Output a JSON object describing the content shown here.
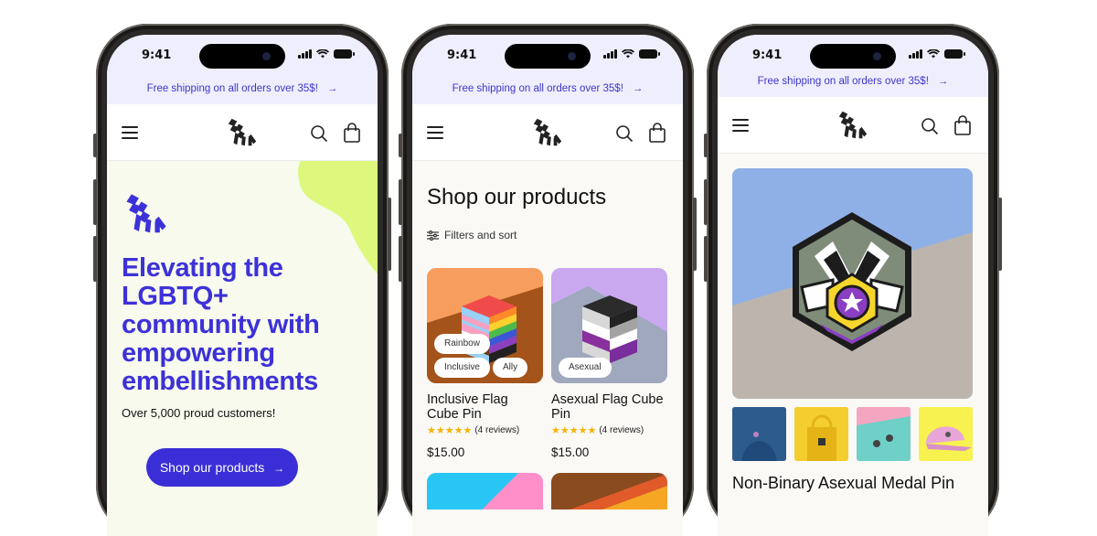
{
  "colors": {
    "brand": "#3a2fd6",
    "announce_bg": "#efeefd",
    "hero_bg": "#f7faed",
    "blob": "#ddf87c",
    "star": "#f5b301"
  },
  "status_bar": {
    "time": "9:41"
  },
  "announcement": {
    "text": "Free shipping on all orders over 35$!",
    "arrow": "→"
  },
  "header": {
    "menu_icon": "hamburger-icon",
    "logo": "brand-logo",
    "search_icon": "search-icon",
    "cart_icon": "shopping-bag-icon"
  },
  "home": {
    "headline": "Elevating the LGBTQ+ community with empowering embellishments",
    "subtext": "Over 5,000 proud customers!",
    "cta_label": "Shop our products",
    "cta_arrow": "→"
  },
  "collection": {
    "title": "Shop our products",
    "filters_label": "Filters and sort",
    "products": [
      {
        "name": "Inclusive Flag Cube Pin",
        "stars": "★★★★★",
        "reviews": "(4 reviews)",
        "price": "$15.00",
        "tags": [
          "Rainbow",
          "Inclusive",
          "Ally"
        ]
      },
      {
        "name": "Asexual Flag Cube Pin",
        "stars": "★★★★★",
        "reviews": "(4 reviews)",
        "price": "$15.00",
        "tags": [
          "Asexual"
        ]
      }
    ]
  },
  "product": {
    "title": "Non-Binary Asexual Medal Pin"
  }
}
